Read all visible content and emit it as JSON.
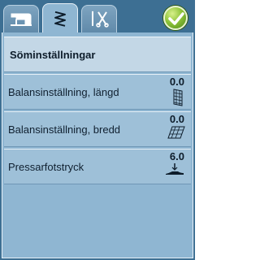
{
  "tabs": [
    {
      "name": "sewing-machine-icon",
      "active": false
    },
    {
      "name": "zigzag-stitch-icon",
      "active": true
    },
    {
      "name": "scissors-needle-icon",
      "active": false
    }
  ],
  "confirm": {
    "icon": "checkmark-icon",
    "color": "#8fc43a"
  },
  "panel": {
    "title": "Söminställningar",
    "rows": [
      {
        "label": "Balansinställning, längd",
        "value": "0.0",
        "icon": "length-balance-icon"
      },
      {
        "label": "Balansinställning, bredd",
        "value": "0.0",
        "icon": "width-balance-icon"
      },
      {
        "label": "Pressarfotstryck",
        "value": "6.0",
        "icon": "presser-foot-pressure-icon"
      }
    ]
  },
  "colors": {
    "background": "#3d6f93",
    "panel": "#8fb6d2",
    "header": "#c3d7e6",
    "row": "#9ec0d8"
  }
}
